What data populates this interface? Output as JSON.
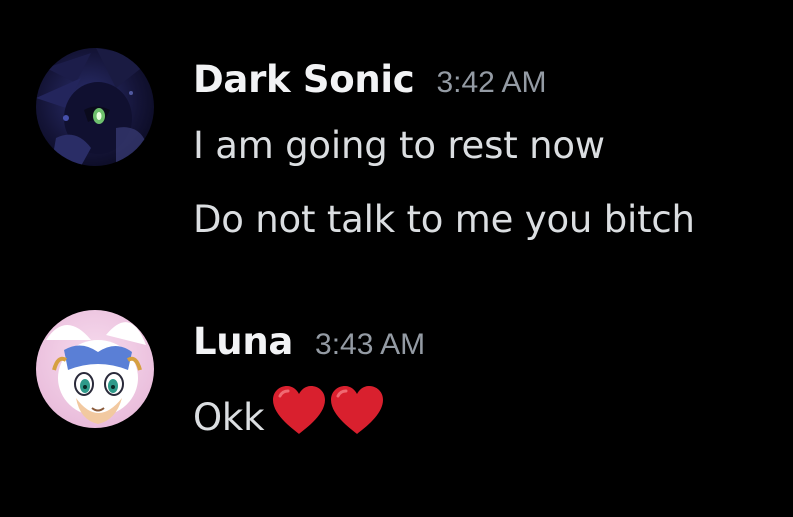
{
  "messages": [
    {
      "author": "Dark Sonic",
      "time": "3:42 AM",
      "avatar": "dark-sonic-avatar",
      "lines": [
        "I am going to rest now",
        "Do not talk to me you bitch"
      ]
    },
    {
      "author": "Luna",
      "time": "3:43 AM",
      "avatar": "rouge-bat-avatar",
      "lines": [
        "Okk"
      ],
      "emoji": [
        "red-heart-icon",
        "red-heart-icon"
      ]
    }
  ],
  "colors": {
    "background": "#000000",
    "username": "#f2f3f5",
    "timestamp": "#949ba4",
    "message_text": "#dbdee1",
    "heart": "#d9202e"
  }
}
